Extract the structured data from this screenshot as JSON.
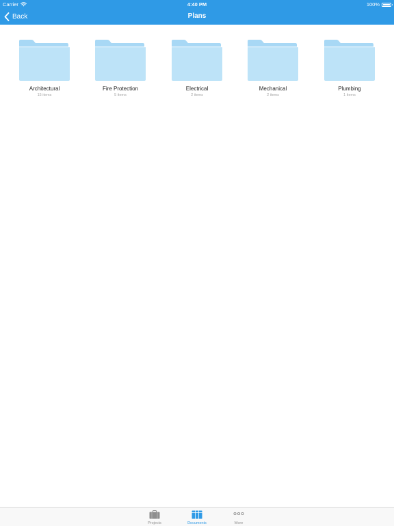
{
  "status_bar": {
    "carrier": "Carrier",
    "time": "4:40 PM",
    "battery": "100%",
    "battery_level": 1.0
  },
  "nav": {
    "back_label": "Back",
    "title": "Plans"
  },
  "folders": [
    {
      "name": "Architectural",
      "count": "15 items"
    },
    {
      "name": "Fire Protection",
      "count": "5 items"
    },
    {
      "name": "Electrical",
      "count": "2 items"
    },
    {
      "name": "Mechanical",
      "count": "2 items"
    },
    {
      "name": "Plumbing",
      "count": "1 items"
    }
  ],
  "tabs": [
    {
      "label": "Projects",
      "icon": "briefcase-icon",
      "active": false
    },
    {
      "label": "Documents",
      "icon": "documents-icon",
      "active": true
    },
    {
      "label": "More",
      "icon": "more-icon",
      "active": false
    }
  ],
  "colors": {
    "accent": "#2f9ae6",
    "folder_back": "#a8d8f5",
    "folder_front": "#bde3f8",
    "tab_inactive": "#8e8e8e"
  }
}
